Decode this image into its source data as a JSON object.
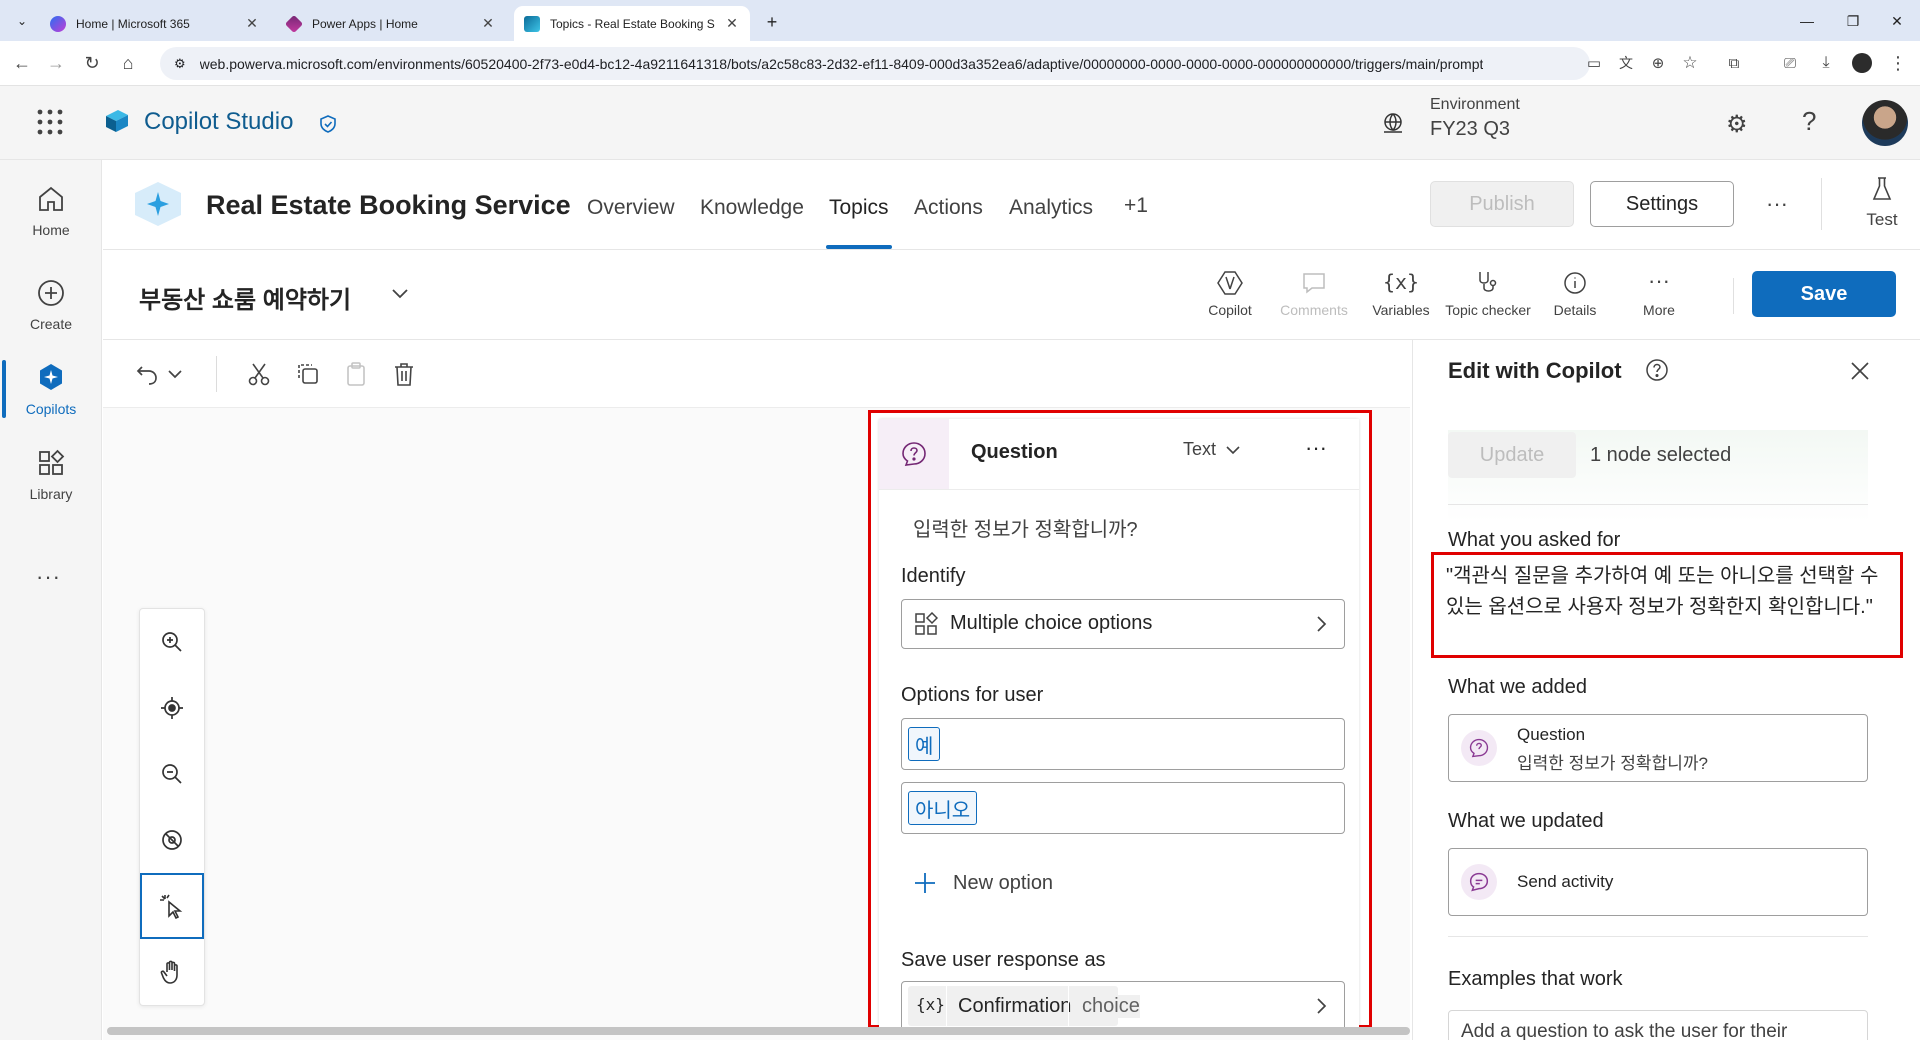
{
  "browser": {
    "tabs": [
      {
        "title": "Home | Microsoft 365",
        "icon": "microsoft365-icon"
      },
      {
        "title": "Power Apps | Home",
        "icon": "powerapps-icon"
      },
      {
        "title": "Topics - Real Estate Booking S",
        "icon": "copilot-studio-icon"
      }
    ],
    "url": "web.powerva.microsoft.com/environments/60520400-2f73-e0d4-bc12-4a9211641318/bots/a2c58c83-2d32-ef11-8409-000d3a352ea6/adaptive/00000000-0000-0000-0000-000000000000/triggers/main/prompt"
  },
  "app": {
    "name": "Copilot Studio",
    "environment_label": "Environment",
    "environment_value": "FY23 Q3"
  },
  "rail": {
    "items": [
      {
        "label": "Home"
      },
      {
        "label": "Create"
      },
      {
        "label": "Copilots"
      },
      {
        "label": "Library"
      }
    ],
    "more": "···"
  },
  "bot": {
    "title": "Real Estate Booking Service",
    "tabs": [
      "Overview",
      "Knowledge",
      "Topics",
      "Actions",
      "Analytics",
      "+1"
    ],
    "publish": "Publish",
    "settings": "Settings",
    "test": "Test"
  },
  "topic": {
    "name": "부동산 쇼룸 예약하기",
    "tools": [
      "Copilot",
      "Comments",
      "Variables",
      "Topic checker",
      "Details",
      "More"
    ],
    "save": "Save"
  },
  "node": {
    "title": "Question",
    "type": "Text",
    "prompt": "입력한 정보가 정확합니까?",
    "identify_label": "Identify",
    "identify_value": "Multiple choice options",
    "options_label": "Options for user",
    "options": [
      "예",
      "아니오"
    ],
    "new_option": "New option",
    "save_label": "Save user response as",
    "variable_name": "Confirmation",
    "variable_type": "choice"
  },
  "panel": {
    "title": "Edit with Copilot",
    "update": "Update",
    "selection": "1 node selected",
    "asked_label": "What you asked for",
    "asked_text": "\"객관식 질문을 추가하여 예 또는 아니오를 선택할 수 있는 옵션으로 사용자 정보가 정확한지 확인합니다.\"",
    "added_label": "What we added",
    "added_title": "Question",
    "added_sub": "입력한 정보가 정확합니까?",
    "updated_label": "What we updated",
    "updated_title": "Send activity",
    "examples_label": "Examples that work",
    "example_text": "Add a question to ask the user for their"
  },
  "colors": {
    "accent": "#0f6cbd",
    "highlight": "#e00000",
    "save": "#0f6cbd"
  }
}
